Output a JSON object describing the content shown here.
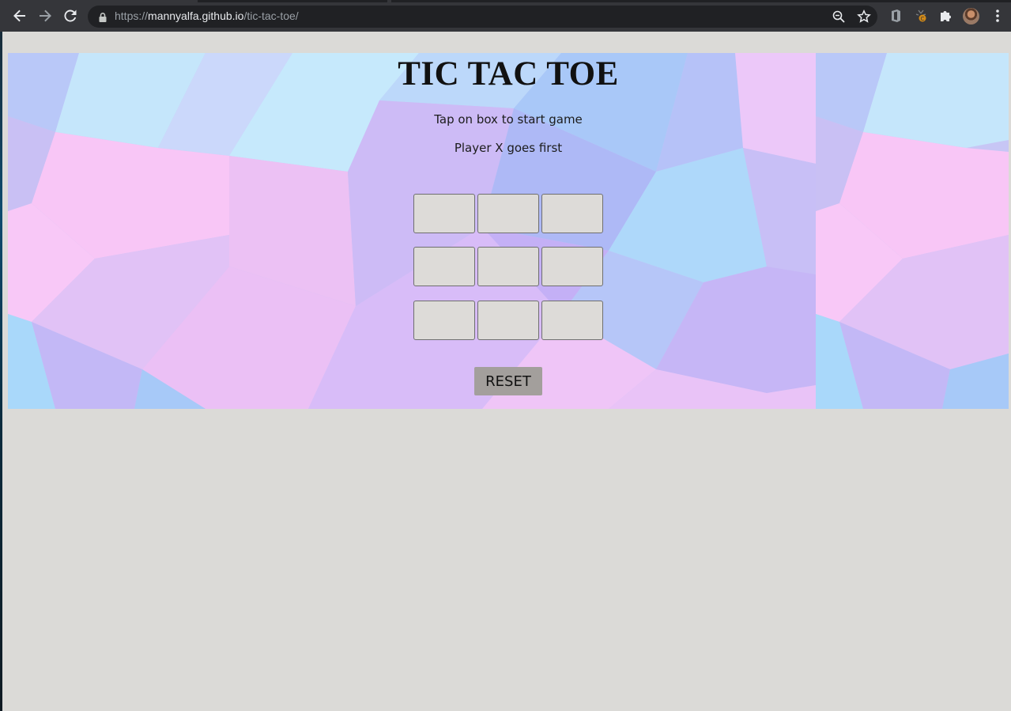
{
  "browser": {
    "url_scheme": "https://",
    "url_host": "mannyalfa.github.io",
    "url_path": "/tic-tac-toe/",
    "icons": {
      "back": "back-arrow-icon",
      "forward": "forward-arrow-icon",
      "reload": "reload-icon",
      "lock": "lock-icon",
      "zoom": "zoom-out-icon",
      "bookmark": "star-icon",
      "extensions": [
        "office-extension-icon",
        "coin-extension-icon",
        "puzzle-extensions-icon"
      ],
      "profile": "profile-avatar",
      "menu": "kebab-menu-icon"
    }
  },
  "game": {
    "title": "TIC TAC TOE",
    "instruction": "Tap on box to start game",
    "turn_text": "Player X goes first",
    "board": [
      [
        "",
        "",
        ""
      ],
      [
        "",
        "",
        ""
      ],
      [
        "",
        "",
        ""
      ]
    ],
    "reset_label": "RESET"
  },
  "colors": {
    "page_background": "#dbdad7",
    "cell_background": "#dddbd8",
    "reset_background": "#a39f9c",
    "hero_pink": "#f7c3f7",
    "hero_blue": "#a6d8fb",
    "hero_violet": "#c3b4f7"
  }
}
